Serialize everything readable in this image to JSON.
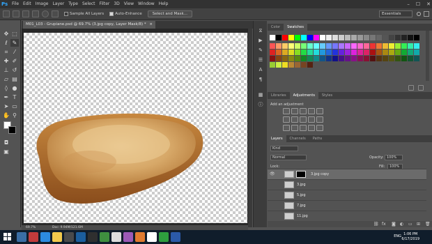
{
  "app": {
    "logo": "Ps"
  },
  "menu": [
    "File",
    "Edit",
    "Image",
    "Layer",
    "Type",
    "Select",
    "Filter",
    "3D",
    "View",
    "Window",
    "Help"
  ],
  "window_controls": {
    "minimize": "–",
    "maximize": "☐",
    "close": "✕"
  },
  "options_bar": {
    "sample_all_layers": "Sample All Layers",
    "auto_enhance": "Auto-Enhance",
    "select_and_mask": "Select and Mask...",
    "workspace": "Essentials"
  },
  "document": {
    "tab_title": "M01_L03 - Grupiane.psd @ 69.7% (3.jpg copy, Layer Mask/8) *",
    "zoom": "69.7%",
    "doc_info": "Doc: 9.94M/121.6M"
  },
  "panels": {
    "color_tabs": [
      "Color",
      "Swatches"
    ],
    "lib_tabs": [
      "Libraries",
      "Adjustments",
      "Styles"
    ],
    "adjustments_title": "Add an adjustment",
    "layer_tabs": [
      "Layers",
      "Channels",
      "Paths"
    ]
  },
  "layers_panel": {
    "kind": "Kind",
    "blend_mode": "Normal",
    "opacity_label": "Opacity:",
    "opacity": "100%",
    "lock_label": "Lock:",
    "fill_label": "Fill:",
    "fill": "100%",
    "layers": [
      {
        "name": "3.jpg copy",
        "selected": true
      },
      {
        "name": "3.jpg",
        "selected": false
      },
      {
        "name": "5.jpg",
        "selected": false
      },
      {
        "name": "7.jpg",
        "selected": false
      },
      {
        "name": "11.jpg",
        "selected": false
      }
    ]
  },
  "swatch_colors": [
    [
      "#ffffff",
      "#000000",
      "#ff0000",
      "#ffff00",
      "#00ff00",
      "#00ffff",
      "#0000ff",
      "#ff00ff",
      "#ffffff",
      "#eeeeee",
      "#dddddd",
      "#cccccc",
      "#bbbbbb",
      "#aaaaaa",
      "#999999",
      "#888888",
      "#777777",
      "#666666",
      "#555555",
      "#444444",
      "#333333",
      "#222222",
      "#111111",
      "#000000"
    ],
    [
      "#ff5555",
      "#ff9966",
      "#ffcc66",
      "#ffff77",
      "#ccff66",
      "#77ff77",
      "#66ffcc",
      "#66ffff",
      "#66ccff",
      "#6699ff",
      "#7777ff",
      "#aa77ff",
      "#cc66ff",
      "#ff66ff",
      "#ff66cc",
      "#ff6699",
      "#ee3333",
      "#ee7733",
      "#eebb33",
      "#eeee33",
      "#99ee33",
      "#33ee55",
      "#33eeaa",
      "#33eeee"
    ],
    [
      "#dd2222",
      "#dd6622",
      "#ddaa22",
      "#dddd22",
      "#88dd22",
      "#22dd44",
      "#22dd99",
      "#22dddd",
      "#2299dd",
      "#2266dd",
      "#2233dd",
      "#6622dd",
      "#9922dd",
      "#dd22dd",
      "#dd2299",
      "#dd2266",
      "#aa1111",
      "#aa5511",
      "#aa8811",
      "#aaaa11",
      "#66aa11",
      "#11aa33",
      "#11aa77",
      "#11aaaa"
    ],
    [
      "#881111",
      "#884411",
      "#886611",
      "#888811",
      "#558811",
      "#118822",
      "#118855",
      "#118888",
      "#115588",
      "#113388",
      "#111188",
      "#441188",
      "#661188",
      "#881188",
      "#881155",
      "#881133",
      "#551111",
      "#553311",
      "#554411",
      "#555511",
      "#335511",
      "#115511",
      "#115533",
      "#115555"
    ],
    [
      "#99cc33",
      "#ccee44",
      "#eedd22",
      "#bb8833",
      "#996633",
      "#774422",
      "#552211"
    ]
  ],
  "taskbar": {
    "language": "ENG",
    "time": "1:06 PM",
    "date": "6/17/2019",
    "icon_colors": [
      "#3a6ea5",
      "#c23b3b",
      "#2c8be0",
      "#f2c94c",
      "#4a4a4a",
      "#1b5e9e",
      "#2f2f2f",
      "#3f8f3f",
      "#dddddd",
      "#9b59b6",
      "#e07b2f",
      "#ffffff",
      "#2e9e3e",
      "#2b5aa8"
    ]
  }
}
